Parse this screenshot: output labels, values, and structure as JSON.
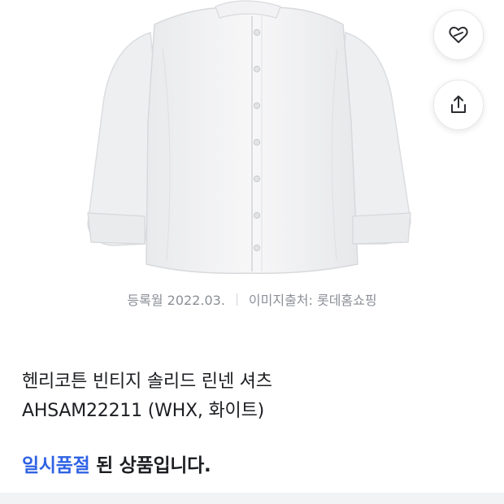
{
  "product": {
    "image_alt": "product-image",
    "registration": "등록월 2022.03.",
    "image_source": "이미지출처: 롯데홈쇼핑",
    "title_line1": "헨리코튼 빈티지 솔리드 린넨 셔츠",
    "title_line2": "AHSAM22211 (WHX, 화이트)"
  },
  "status": {
    "highlight": "일시품절",
    "rest": " 된 상품입니다."
  },
  "actions": {
    "wishlist_icon": "heart-icon",
    "share_icon": "share-icon"
  },
  "colors": {
    "accent": "#2f63e4",
    "text": "#1c1e22",
    "muted": "#8b8f96"
  }
}
